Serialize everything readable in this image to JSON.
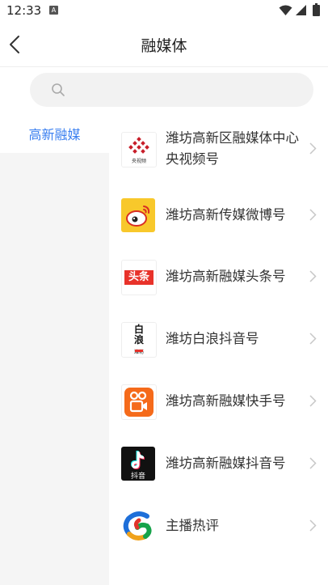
{
  "status_bar": {
    "time": "12:33",
    "indicator": "A"
  },
  "header": {
    "title": "融媒体"
  },
  "search": {
    "placeholder": ""
  },
  "category": {
    "active_label": "高新融媒"
  },
  "items": [
    {
      "label": "潍坊高新区融媒体中心央视频号",
      "icon": "cctv-video-logo",
      "logo_text": "央视频"
    },
    {
      "label": "潍坊高新传媒微博号",
      "icon": "weibo-logo"
    },
    {
      "label": "潍坊高新融媒头条号",
      "icon": "toutiao-logo",
      "logo_text": "头条"
    },
    {
      "label": "潍坊白浪抖音号",
      "icon": "bailang-logo",
      "logo_text": "白浪",
      "logo_sub": "潍坊"
    },
    {
      "label": "潍坊高新融媒快手号",
      "icon": "kuaishou-logo"
    },
    {
      "label": "潍坊高新融媒抖音号",
      "icon": "douyin-logo",
      "logo_text": "抖音"
    },
    {
      "label": "主播热评",
      "icon": "zhubo-reping-logo"
    }
  ],
  "colors": {
    "accent": "#3a7ff0",
    "panel_bg": "#f5f5f5",
    "search_bg": "#f2f2f2"
  }
}
